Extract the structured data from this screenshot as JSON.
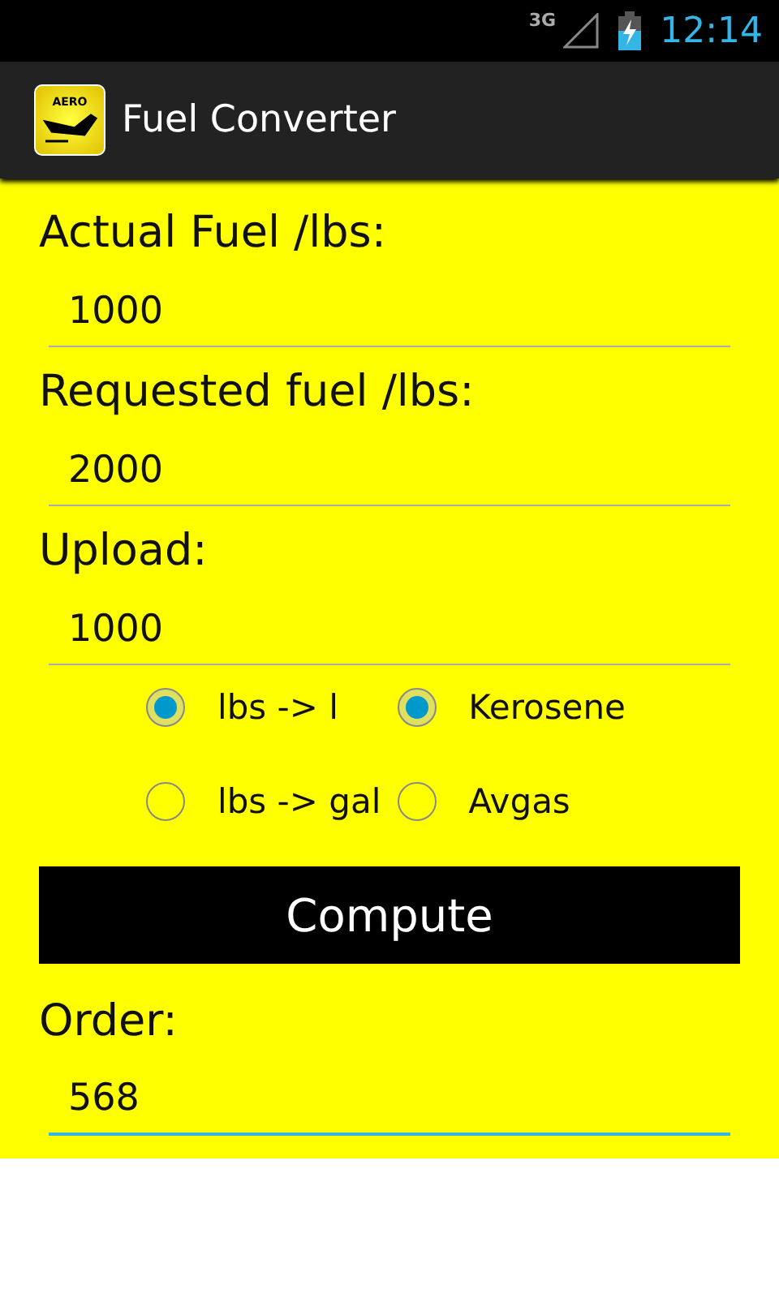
{
  "status_bar": {
    "network": "3G",
    "time": "12:14"
  },
  "app_bar": {
    "logo_text": "AERO",
    "title": "Fuel Converter"
  },
  "fields": [
    {
      "label": "Actual Fuel /lbs:",
      "value": "1000",
      "focused": false
    },
    {
      "label": "Requested fuel /lbs:",
      "value": "2000",
      "focused": false
    },
    {
      "label": "Upload:",
      "value": "1000",
      "focused": false
    }
  ],
  "radio_groups": [
    {
      "options": [
        {
          "label": "lbs -> l",
          "selected": true
        },
        {
          "label": "lbs -> gal",
          "selected": false
        }
      ]
    },
    {
      "options": [
        {
          "label": "Kerosene",
          "selected": true
        },
        {
          "label": "Avgas",
          "selected": false
        }
      ]
    }
  ],
  "button": "Compute",
  "result": {
    "label": "Order:",
    "value": "568",
    "focused": true
  }
}
